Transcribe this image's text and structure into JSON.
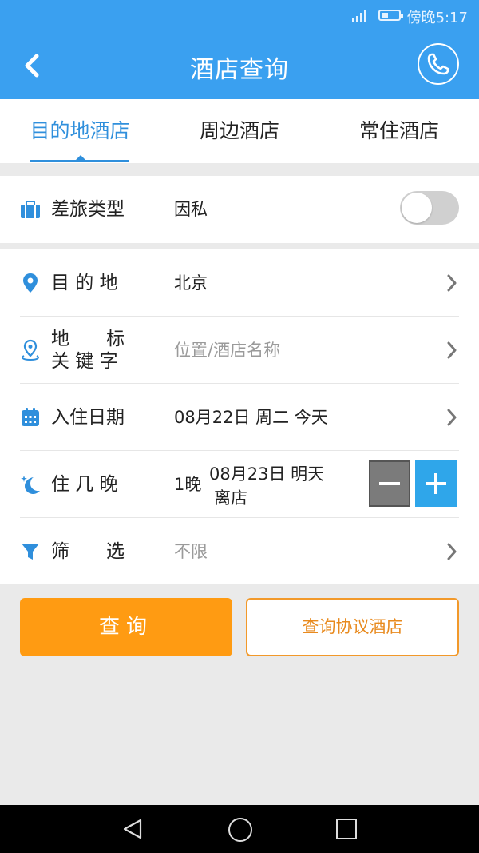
{
  "status_bar": {
    "time": "傍晚5:17",
    "battery_level": 0.4
  },
  "header": {
    "title": "酒店查询"
  },
  "tabs": [
    {
      "label": "目的地酒店",
      "active": true
    },
    {
      "label": "周边酒店",
      "active": false
    },
    {
      "label": "常住酒店",
      "active": false
    }
  ],
  "travel_type": {
    "label": "差旅类型",
    "value": "因私",
    "toggle_on": false
  },
  "form": {
    "destination": {
      "label": "目 的 地",
      "value": "北京"
    },
    "landmark": {
      "label_line1": "地　　标",
      "label_line2": "关 键 字",
      "placeholder": "位置/酒店名称"
    },
    "checkin": {
      "label": "入住日期",
      "value": "08月22日 周二 今天"
    },
    "nights": {
      "label": "住 几 晚",
      "count": "1晚",
      "checkout_line1": "08月23日 明天",
      "checkout_line2": "离店"
    },
    "filter": {
      "label": "筛　　选",
      "value": "不限"
    }
  },
  "buttons": {
    "search": "查询",
    "agreement": "查询协议酒店"
  },
  "colors": {
    "primary": "#3aa0f0",
    "accent_orange": "#ff9b12",
    "tab_active": "#2f8fdc"
  }
}
